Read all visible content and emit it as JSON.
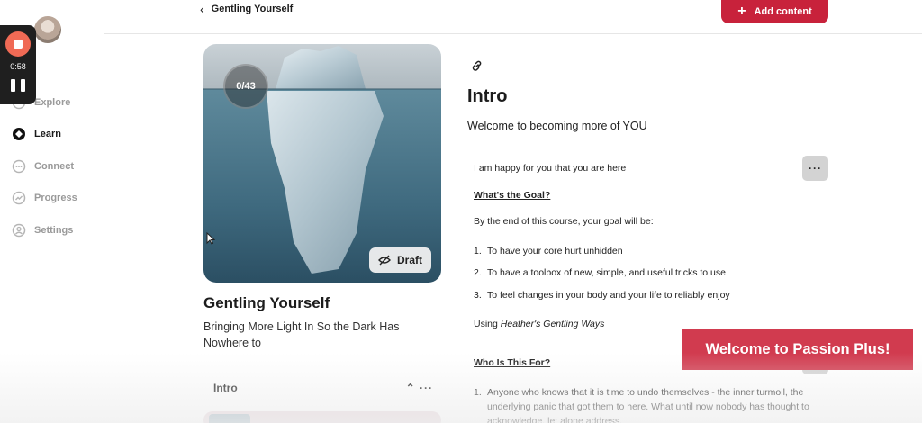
{
  "recorder": {
    "time": "0:58"
  },
  "sidebar": {
    "items": [
      {
        "label": "Explore",
        "icon": "compass-icon",
        "active": false
      },
      {
        "label": "Learn",
        "icon": "learn-icon",
        "active": true
      },
      {
        "label": "Connect",
        "icon": "chat-icon",
        "active": false
      },
      {
        "label": "Progress",
        "icon": "trend-icon",
        "active": false
      },
      {
        "label": "Settings",
        "icon": "gear-icon",
        "active": false
      }
    ]
  },
  "header": {
    "back_title": "Gentling Yourself",
    "add_label": "Add content"
  },
  "course": {
    "progress": "0/43",
    "draft_label": "Draft",
    "title": "Gentling Yourself",
    "subtitle": "Bringing More Light In So the Dark Has Nowhere to",
    "section_label": "Intro"
  },
  "lesson": {
    "heading": "Intro",
    "welcome": "Welcome to becoming more of YOU",
    "p1": "I am happy for you that you are here",
    "goal_heading": "What's the Goal?",
    "goal_intro": "By the end of this course, your goal will be:",
    "goals": [
      "To have your core hurt unhidden",
      "To have a toolbox of new, simple, and useful tricks to use",
      "To feel changes in your body and your life to reliably enjoy"
    ],
    "using_prefix": "Using ",
    "using_em": "Heather's Gentling Ways",
    "who_heading": "Who Is This For?",
    "who_item": "Anyone who knows that it is time to undo themselves - the inner turmoil, the underlying panic that got them to here. What until now nobody has thought to acknowledge, let alone address."
  },
  "toast": {
    "text": "Welcome to Passion Plus!"
  },
  "colors": {
    "accent": "#c8223b",
    "toast": "#d13b4f",
    "recorder": "#f06a55"
  }
}
